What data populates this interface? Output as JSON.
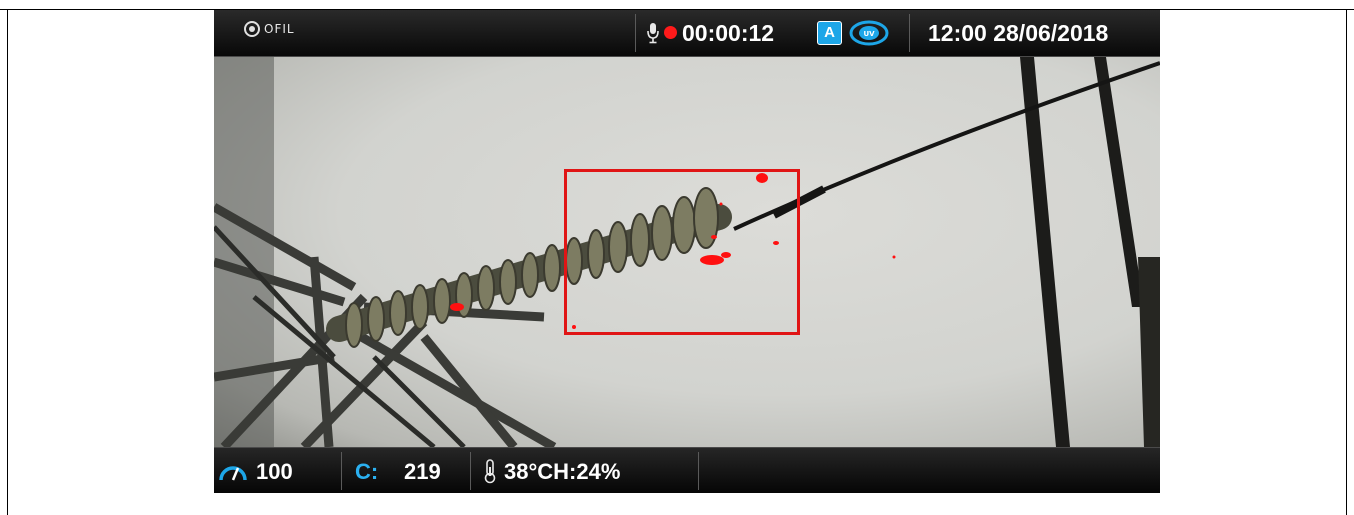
{
  "camera_ui": {
    "brand": "OFIL",
    "recording_time": "00:00:12",
    "auto_mode_badge": "A",
    "uv_badge": "UV",
    "datetime": "12:00 28/06/2018",
    "gain": "100",
    "count_label": "C:",
    "count_value": "219",
    "environment": "38°CH:24%"
  },
  "colors": {
    "recording_dot": "#ff1a1a",
    "detection_box": "#e01515",
    "accent_blue": "#1da6e8",
    "count_label": "#2bb0f0"
  },
  "icons": {
    "logo": "ofil-logo-icon",
    "microphone": "microphone-icon",
    "record": "record-dot-icon",
    "auto_mode": "auto-mode-icon",
    "uv": "uv-mode-icon",
    "gain": "gauge-icon",
    "temperature": "thermometer-icon"
  }
}
